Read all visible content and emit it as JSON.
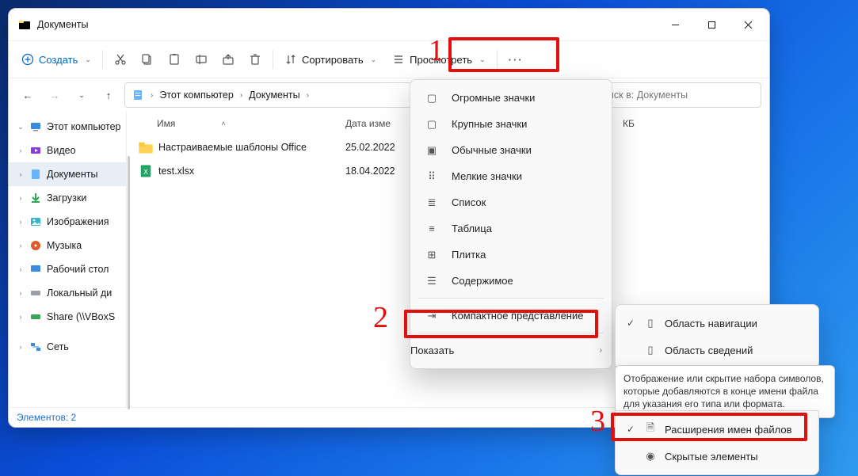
{
  "title": "Документы",
  "windowButtons": {
    "min": "–",
    "max": "☐",
    "close": "✕"
  },
  "toolbar": {
    "new": "Создать",
    "sort": "Сортировать",
    "view": "Просмотреть",
    "more": "···"
  },
  "nav": {
    "back": "←",
    "fwd": "→",
    "up": "↑"
  },
  "breadcrumb": {
    "root": "Этот компьютер",
    "current": "Документы"
  },
  "search": {
    "placeholder": "Поиск в: Документы"
  },
  "sidebar": {
    "top": "Этот компьютер",
    "items": [
      {
        "label": "Видео",
        "icon": "video"
      },
      {
        "label": "Документы",
        "icon": "doc",
        "selected": true
      },
      {
        "label": "Загрузки",
        "icon": "down"
      },
      {
        "label": "Изображения",
        "icon": "img"
      },
      {
        "label": "Музыка",
        "icon": "music"
      },
      {
        "label": "Рабочий стол",
        "icon": "desk"
      },
      {
        "label": "Локальный ди",
        "icon": "disk"
      },
      {
        "label": "Share (\\\\VBoxS",
        "icon": "disk"
      }
    ],
    "net": "Сеть"
  },
  "columns": {
    "name": "Имя",
    "date": "Дата изме",
    "type": "",
    "size": "КБ"
  },
  "files": [
    {
      "name": "Настраиваемые шаблоны Office",
      "date": "25.02.2022",
      "type": "folder"
    },
    {
      "name": "test.xlsx",
      "date": "18.04.2022",
      "type": "xlsx"
    }
  ],
  "status": {
    "count_label": "Элементов:",
    "count": "2"
  },
  "viewMenu": {
    "items": [
      "Огромные значки",
      "Крупные значки",
      "Обычные значки",
      "Мелкие значки",
      "Список",
      "Таблица",
      "Плитка",
      "Содержимое"
    ],
    "compact": "Компактное представление",
    "show": "Показать"
  },
  "showMenu": {
    "navPane": "Область навигации",
    "detailsPane": "Область сведений",
    "ext": "Расширения имен файлов",
    "hidden": "Скрытые элементы"
  },
  "tooltip": "Отображение или скрытие набора символов, которые добавляются в конце имени файла для указания его типа или формата.",
  "annotations": {
    "n1": "1",
    "n2": "2",
    "n3": "3"
  }
}
